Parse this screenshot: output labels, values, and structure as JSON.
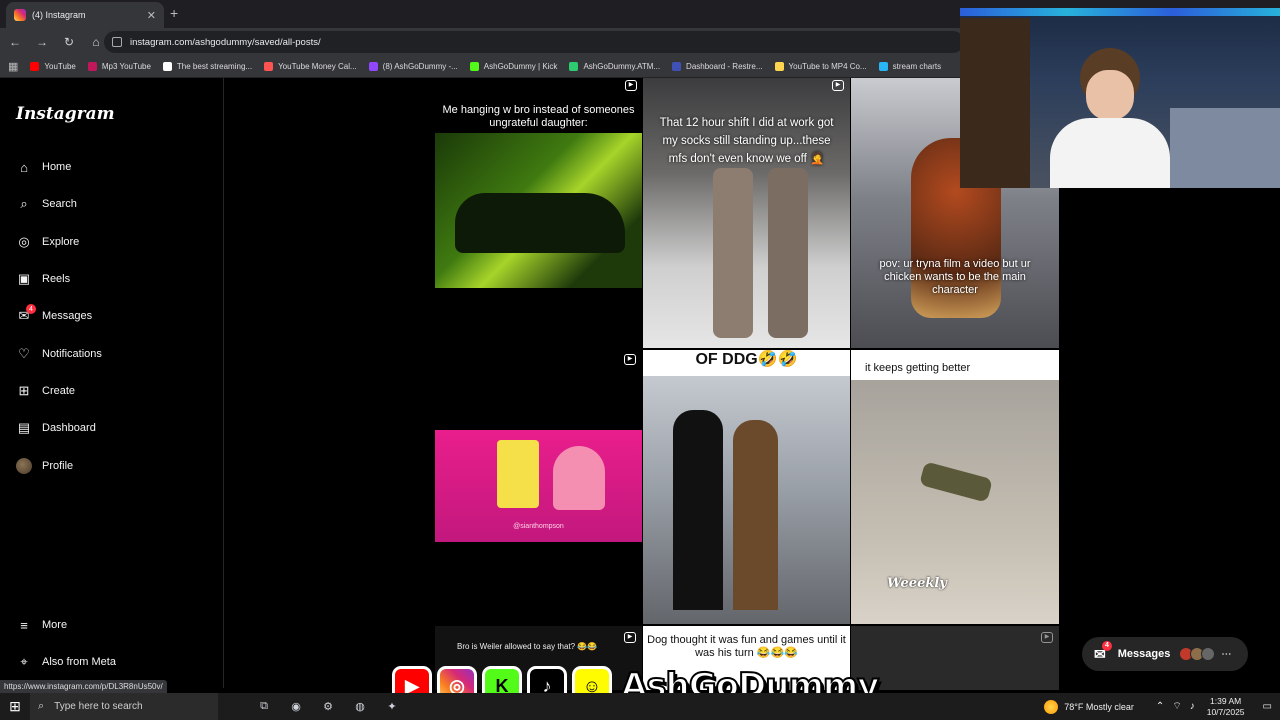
{
  "browser": {
    "tab_title": "(4) Instagram",
    "new_tab": "+",
    "tab_close": "✕",
    "url": "instagram.com/ashgodummy/saved/all-posts/",
    "bookmarks": [
      {
        "label": "YouTube",
        "color": "#ff0000"
      },
      {
        "label": "Mp3 YouTube",
        "color": "#c2185b"
      },
      {
        "label": "The best streaming...",
        "color": "#ffffff"
      },
      {
        "label": "YouTube Money Cal...",
        "color": "#ff5252"
      },
      {
        "label": "(8) AshGoDummy -...",
        "color": "#9146ff"
      },
      {
        "label": "AshGoDummy | Kick",
        "color": "#53fc18"
      },
      {
        "label": "AshGoDummy.ATM...",
        "color": "#2ecc71"
      },
      {
        "label": "Dashboard - Restre...",
        "color": "#3f51b5"
      },
      {
        "label": "YouTube to MP4 Co...",
        "color": "#ffd54f"
      },
      {
        "label": "stream charts",
        "color": "#29b6f6"
      }
    ],
    "status_url": "https://www.instagram.com/p/DL3R8nUs50v/"
  },
  "instagram": {
    "logo": "Instagram",
    "nav": [
      {
        "label": "Home",
        "icon": "home-icon"
      },
      {
        "label": "Search",
        "icon": "search-icon"
      },
      {
        "label": "Explore",
        "icon": "explore-icon"
      },
      {
        "label": "Reels",
        "icon": "reels-icon"
      },
      {
        "label": "Messages",
        "icon": "messages-icon",
        "badge": "4"
      },
      {
        "label": "Notifications",
        "icon": "heart-icon"
      },
      {
        "label": "Create",
        "icon": "create-icon"
      },
      {
        "label": "Dashboard",
        "icon": "dashboard-icon"
      },
      {
        "label": "Profile",
        "icon": "avatar"
      }
    ],
    "more": "More",
    "also_from_meta": "Also from Meta",
    "posts": [
      {
        "caption": "Me hanging w bro instead of someones ungrateful daughter:"
      },
      {
        "caption": "That 12 hour shift I did at work got my socks still standing up...these mfs don't even know we off 🤦"
      },
      {
        "caption": "pov: ur tryna film a video but ur chicken wants to be the main character"
      },
      {
        "caption": "@sianthompson"
      },
      {
        "caption": "OF DDG🤣🤣"
      },
      {
        "caption": "it keeps getting better"
      },
      {
        "caption": "Bro is Weiler allowed to say that? 😂😂"
      },
      {
        "caption": "Dog thought it was fun and games until it was his turn 😂😂😂"
      },
      {
        "caption": "Weeekly"
      }
    ],
    "messages_pill": {
      "label": "Messages",
      "badge": "4"
    }
  },
  "overlay": {
    "streamer_name": "AshGoDummy"
  },
  "taskbar": {
    "search_placeholder": "Type here to search",
    "weather": "78°F  Mostly clear",
    "time": "1:39 AM",
    "date": "10/7/2025"
  }
}
